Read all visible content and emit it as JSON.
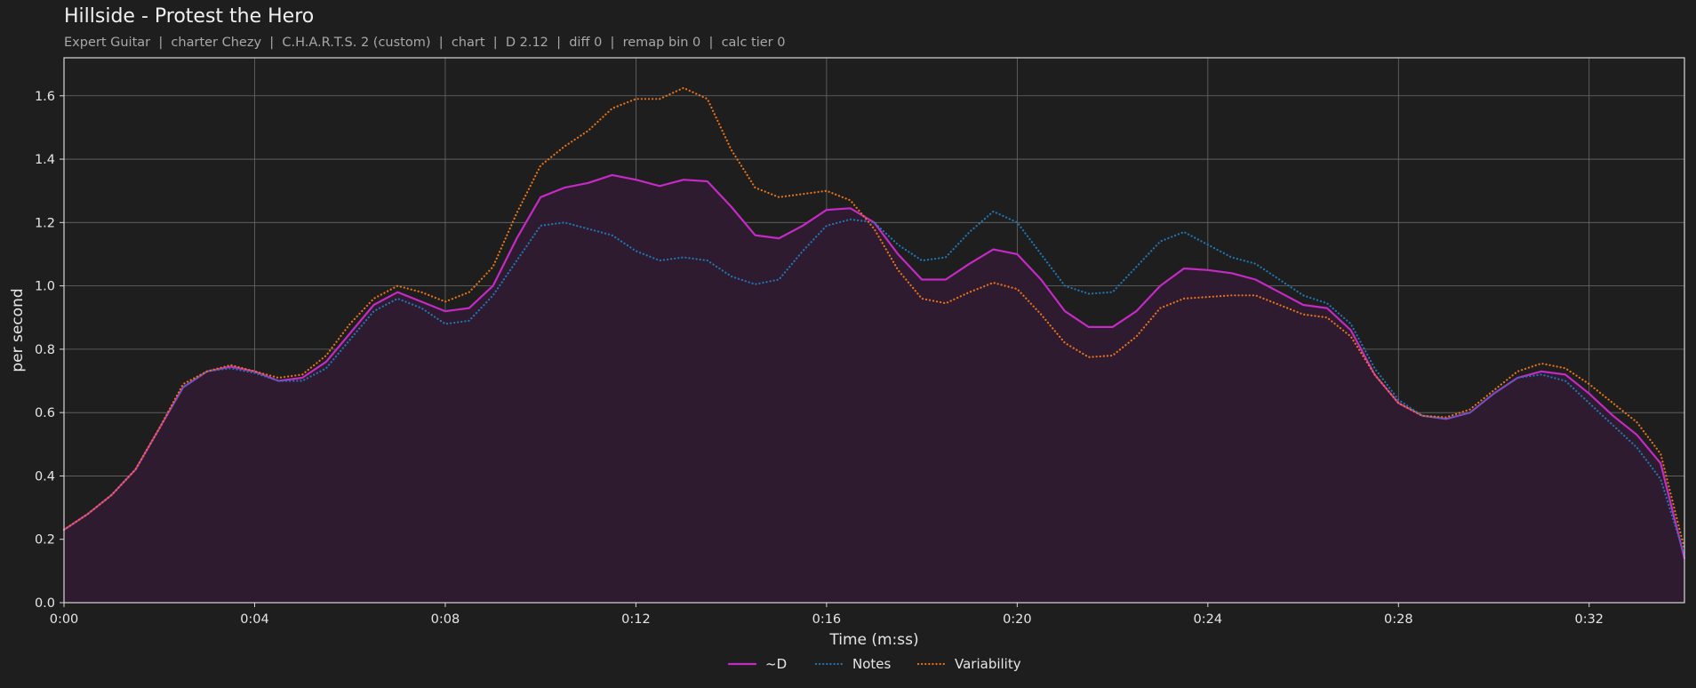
{
  "header": {
    "title": "Hillside - Protest the Hero",
    "subtitle": "Expert Guitar  |  charter Chezy  |  C.H.A.R.T.S. 2 (custom)  |  chart  |  D 2.12  |  diff 0  |  remap bin 0  |  calc tier 0"
  },
  "colors": {
    "background": "#1e1e1e",
    "grid": "#6a6a6a",
    "d_series": "#c42ac4",
    "notes_series": "#1f77b4",
    "variability_series": "#e8731a",
    "area_fill": "#2f1b2f"
  },
  "chart_data": {
    "type": "line",
    "xlabel": "Time (m:ss)",
    "ylabel": "per second",
    "xlim": [
      0,
      34
    ],
    "ylim": [
      0,
      1.72
    ],
    "x_unit": "seconds",
    "xticks": [
      0,
      4,
      8,
      12,
      16,
      20,
      24,
      28,
      32
    ],
    "xtick_labels": [
      "0:00",
      "0:04",
      "0:08",
      "0:12",
      "0:16",
      "0:20",
      "0:24",
      "0:28",
      "0:32"
    ],
    "yticks": [
      0.0,
      0.2,
      0.4,
      0.6,
      0.8,
      1.0,
      1.2,
      1.4,
      1.6
    ],
    "ytick_labels": [
      "0.0",
      "0.2",
      "0.4",
      "0.6",
      "0.8",
      "1.0",
      "1.2",
      "1.4",
      "1.6"
    ],
    "grid": true,
    "legend_position": "bottom-center",
    "series": [
      {
        "name": "~D",
        "style": "solid",
        "area": true,
        "points": [
          [
            0,
            0.23
          ],
          [
            0.5,
            0.28
          ],
          [
            1,
            0.34
          ],
          [
            1.5,
            0.42
          ],
          [
            2,
            0.55
          ],
          [
            2.5,
            0.68
          ],
          [
            3,
            0.73
          ],
          [
            3.5,
            0.745
          ],
          [
            4,
            0.73
          ],
          [
            4.5,
            0.7
          ],
          [
            5,
            0.71
          ],
          [
            5.5,
            0.76
          ],
          [
            6,
            0.85
          ],
          [
            6.5,
            0.94
          ],
          [
            7,
            0.98
          ],
          [
            7.5,
            0.95
          ],
          [
            8,
            0.92
          ],
          [
            8.5,
            0.93
          ],
          [
            9,
            1.0
          ],
          [
            9.5,
            1.15
          ],
          [
            10,
            1.28
          ],
          [
            10.5,
            1.31
          ],
          [
            11,
            1.325
          ],
          [
            11.5,
            1.35
          ],
          [
            12,
            1.335
          ],
          [
            12.5,
            1.315
          ],
          [
            13,
            1.335
          ],
          [
            13.5,
            1.33
          ],
          [
            14,
            1.25
          ],
          [
            14.5,
            1.16
          ],
          [
            15,
            1.15
          ],
          [
            15.5,
            1.19
          ],
          [
            16,
            1.24
          ],
          [
            16.5,
            1.245
          ],
          [
            17,
            1.2
          ],
          [
            17.5,
            1.1
          ],
          [
            18,
            1.02
          ],
          [
            18.5,
            1.02
          ],
          [
            19,
            1.07
          ],
          [
            19.5,
            1.115
          ],
          [
            20,
            1.1
          ],
          [
            20.5,
            1.02
          ],
          [
            21,
            0.92
          ],
          [
            21.5,
            0.87
          ],
          [
            22,
            0.87
          ],
          [
            22.5,
            0.92
          ],
          [
            23,
            1.0
          ],
          [
            23.5,
            1.055
          ],
          [
            24,
            1.05
          ],
          [
            24.5,
            1.04
          ],
          [
            25,
            1.02
          ],
          [
            25.5,
            0.98
          ],
          [
            26,
            0.94
          ],
          [
            26.5,
            0.93
          ],
          [
            27,
            0.86
          ],
          [
            27.5,
            0.72
          ],
          [
            28,
            0.63
          ],
          [
            28.5,
            0.59
          ],
          [
            29,
            0.58
          ],
          [
            29.5,
            0.6
          ],
          [
            30,
            0.66
          ],
          [
            30.5,
            0.71
          ],
          [
            31,
            0.73
          ],
          [
            31.5,
            0.72
          ],
          [
            32,
            0.66
          ],
          [
            32.5,
            0.59
          ],
          [
            33,
            0.53
          ],
          [
            33.5,
            0.44
          ],
          [
            34,
            0.14
          ]
        ]
      },
      {
        "name": "Notes",
        "style": "dotted",
        "points": [
          [
            0,
            0.23
          ],
          [
            0.5,
            0.28
          ],
          [
            1,
            0.34
          ],
          [
            1.5,
            0.42
          ],
          [
            2,
            0.55
          ],
          [
            2.5,
            0.68
          ],
          [
            3,
            0.73
          ],
          [
            3.5,
            0.74
          ],
          [
            4,
            0.725
          ],
          [
            4.5,
            0.7
          ],
          [
            5,
            0.7
          ],
          [
            5.5,
            0.74
          ],
          [
            6,
            0.83
          ],
          [
            6.5,
            0.92
          ],
          [
            7,
            0.96
          ],
          [
            7.5,
            0.93
          ],
          [
            8,
            0.88
          ],
          [
            8.5,
            0.89
          ],
          [
            9,
            0.97
          ],
          [
            9.5,
            1.08
          ],
          [
            10,
            1.19
          ],
          [
            10.5,
            1.2
          ],
          [
            11,
            1.18
          ],
          [
            11.5,
            1.16
          ],
          [
            12,
            1.11
          ],
          [
            12.5,
            1.08
          ],
          [
            13,
            1.09
          ],
          [
            13.5,
            1.08
          ],
          [
            14,
            1.03
          ],
          [
            14.5,
            1.005
          ],
          [
            15,
            1.02
          ],
          [
            15.5,
            1.11
          ],
          [
            16,
            1.19
          ],
          [
            16.5,
            1.21
          ],
          [
            17,
            1.2
          ],
          [
            17.5,
            1.13
          ],
          [
            18,
            1.08
          ],
          [
            18.5,
            1.09
          ],
          [
            19,
            1.17
          ],
          [
            19.5,
            1.235
          ],
          [
            20,
            1.2
          ],
          [
            20.5,
            1.1
          ],
          [
            21,
            1.0
          ],
          [
            21.5,
            0.975
          ],
          [
            22,
            0.98
          ],
          [
            22.5,
            1.06
          ],
          [
            23,
            1.14
          ],
          [
            23.5,
            1.17
          ],
          [
            24,
            1.13
          ],
          [
            24.5,
            1.09
          ],
          [
            25,
            1.07
          ],
          [
            25.5,
            1.02
          ],
          [
            26,
            0.97
          ],
          [
            26.5,
            0.945
          ],
          [
            27,
            0.88
          ],
          [
            27.5,
            0.74
          ],
          [
            28,
            0.64
          ],
          [
            28.5,
            0.59
          ],
          [
            29,
            0.58
          ],
          [
            29.5,
            0.6
          ],
          [
            30,
            0.66
          ],
          [
            30.5,
            0.71
          ],
          [
            31,
            0.72
          ],
          [
            31.5,
            0.7
          ],
          [
            32,
            0.63
          ],
          [
            32.5,
            0.56
          ],
          [
            33,
            0.49
          ],
          [
            33.5,
            0.39
          ],
          [
            34,
            0.15
          ]
        ]
      },
      {
        "name": "Variability",
        "style": "dotted",
        "points": [
          [
            0,
            0.23
          ],
          [
            0.5,
            0.28
          ],
          [
            1,
            0.34
          ],
          [
            1.5,
            0.42
          ],
          [
            2,
            0.55
          ],
          [
            2.5,
            0.69
          ],
          [
            3,
            0.73
          ],
          [
            3.5,
            0.75
          ],
          [
            4,
            0.73
          ],
          [
            4.5,
            0.71
          ],
          [
            5,
            0.72
          ],
          [
            5.5,
            0.78
          ],
          [
            6,
            0.88
          ],
          [
            6.5,
            0.96
          ],
          [
            7,
            1.0
          ],
          [
            7.5,
            0.98
          ],
          [
            8,
            0.95
          ],
          [
            8.5,
            0.98
          ],
          [
            9,
            1.06
          ],
          [
            9.5,
            1.23
          ],
          [
            10,
            1.38
          ],
          [
            10.5,
            1.44
          ],
          [
            11,
            1.49
          ],
          [
            11.5,
            1.56
          ],
          [
            12,
            1.59
          ],
          [
            12.5,
            1.59
          ],
          [
            13,
            1.625
          ],
          [
            13.5,
            1.59
          ],
          [
            14,
            1.43
          ],
          [
            14.5,
            1.31
          ],
          [
            15,
            1.28
          ],
          [
            15.5,
            1.29
          ],
          [
            16,
            1.3
          ],
          [
            16.5,
            1.27
          ],
          [
            17,
            1.18
          ],
          [
            17.5,
            1.05
          ],
          [
            18,
            0.96
          ],
          [
            18.5,
            0.945
          ],
          [
            19,
            0.98
          ],
          [
            19.5,
            1.01
          ],
          [
            20,
            0.99
          ],
          [
            20.5,
            0.91
          ],
          [
            21,
            0.82
          ],
          [
            21.5,
            0.775
          ],
          [
            22,
            0.78
          ],
          [
            22.5,
            0.84
          ],
          [
            23,
            0.93
          ],
          [
            23.5,
            0.96
          ],
          [
            24,
            0.965
          ],
          [
            24.5,
            0.97
          ],
          [
            25,
            0.97
          ],
          [
            25.5,
            0.94
          ],
          [
            26,
            0.91
          ],
          [
            26.5,
            0.9
          ],
          [
            27,
            0.84
          ],
          [
            27.5,
            0.72
          ],
          [
            28,
            0.63
          ],
          [
            28.5,
            0.59
          ],
          [
            29,
            0.585
          ],
          [
            29.5,
            0.61
          ],
          [
            30,
            0.67
          ],
          [
            30.5,
            0.73
          ],
          [
            31,
            0.755
          ],
          [
            31.5,
            0.74
          ],
          [
            32,
            0.69
          ],
          [
            32.5,
            0.63
          ],
          [
            33,
            0.57
          ],
          [
            33.5,
            0.47
          ],
          [
            34,
            0.17
          ]
        ]
      }
    ]
  }
}
